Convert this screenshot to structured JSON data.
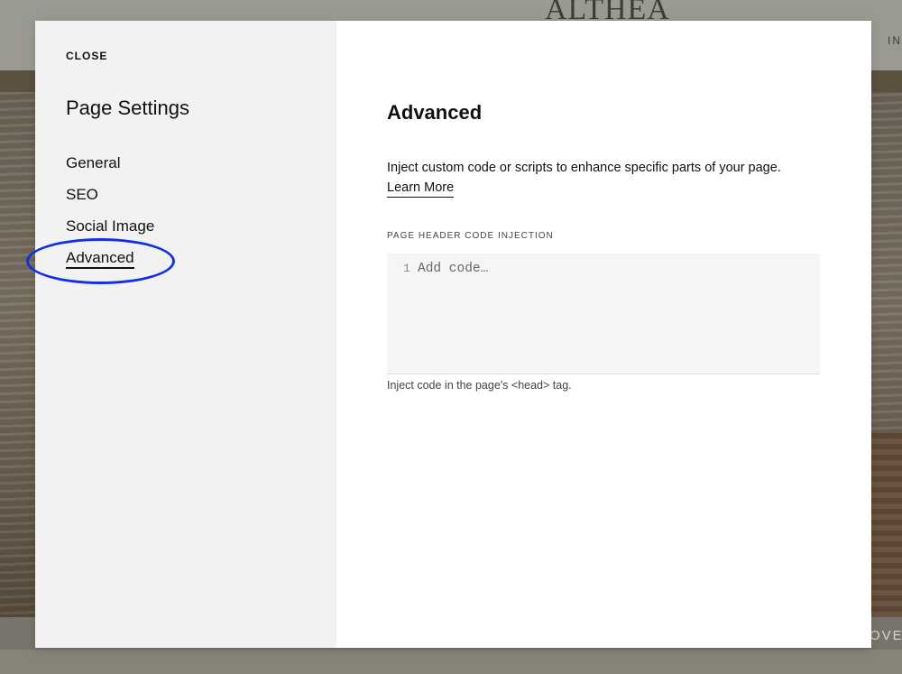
{
  "background": {
    "logo": "ALTHEA",
    "nav_fragment": "IN",
    "footer_fragment": "OVER"
  },
  "sidebar": {
    "close_label": "CLOSE",
    "title": "Page Settings",
    "items": [
      {
        "label": "General",
        "active": false
      },
      {
        "label": "SEO",
        "active": false
      },
      {
        "label": "Social Image",
        "active": false
      },
      {
        "label": "Advanced",
        "active": true
      }
    ]
  },
  "content": {
    "title": "Advanced",
    "description": "Inject custom code or scripts to enhance specific parts of your page.",
    "learn_more": "Learn More",
    "field_label": "PAGE HEADER CODE INJECTION",
    "line_number": "1",
    "code_placeholder": "Add code…",
    "field_help": "Inject code in the page's <head> tag."
  },
  "colors": {
    "annotation": "#1030e8",
    "sidebar_bg": "#f2f2f2",
    "code_bg": "#f5f5f5"
  }
}
